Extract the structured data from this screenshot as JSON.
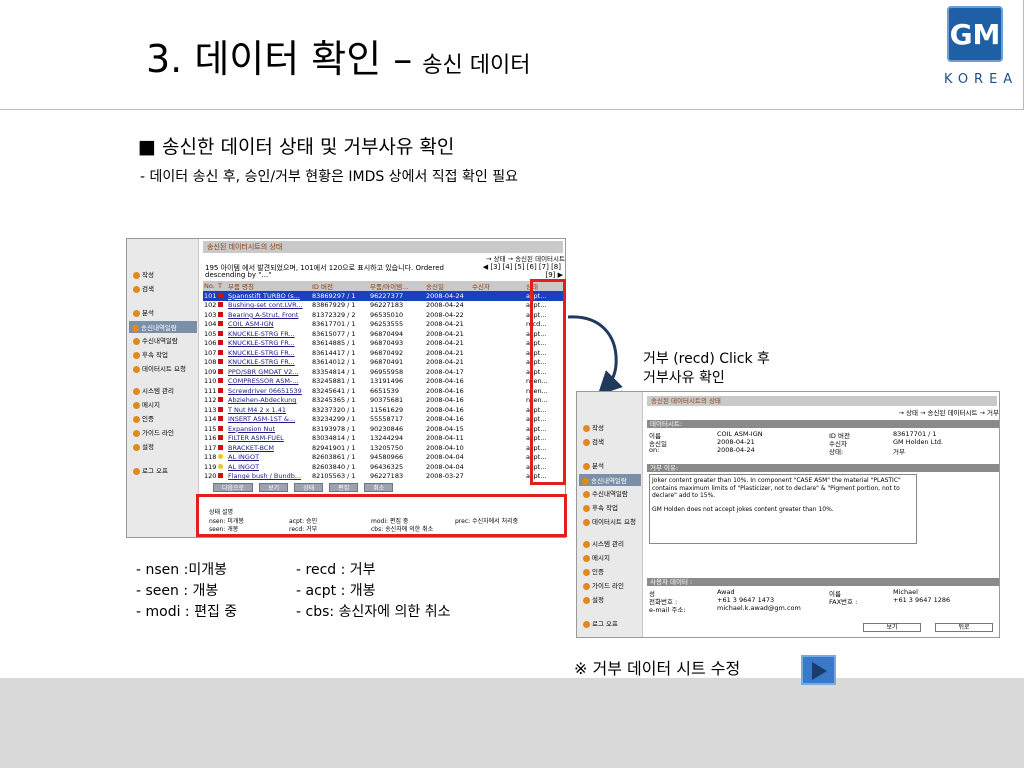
{
  "title": {
    "main": "3. 데이터 확인 –",
    "sub": "송신 데이터"
  },
  "logo": {
    "mark": "GM",
    "sub": "KOREA"
  },
  "heading": "■ 송신한 데이터 상태 및 거부사유 확인",
  "subline": "- 데이터 송신 후, 승인/거부 현황은 IMDS 상에서 직접 확인 필요",
  "screen1": {
    "sidebar": [
      "작성",
      "검색",
      "분석",
      "송신내역일람",
      "수신내역일람",
      "후속 작업",
      "데이터시트 요청",
      "시스템 관리",
      "메시지",
      "인증",
      "가이드 라인",
      "설정",
      "로그 오프"
    ],
    "selected_index": 3,
    "panel_title": "송신된 데이터시트의 상태",
    "legend": "→ 상태 → 송신된 데이터시트",
    "info": "195 아이템 에서 발견되었으며, 101에서 120으로 표시하고 있습니다.   Ordered",
    "info2": "descending by \"...\"",
    "pages": "◀ [3] [4] [5] [6] [7] [8]",
    "pages2": "[9] ▶",
    "columns": [
      "No.",
      "T",
      "부품 명칭",
      "ID 버전",
      "부품/아이템...",
      "송신일",
      "수신자",
      "상태"
    ],
    "rows": [
      [
        "101",
        "",
        "Spannstift TURBO (s...",
        "83869297 / 1",
        "96227377",
        "2008-04-24",
        "",
        "acpt..."
      ],
      [
        "102",
        "",
        "Bushing-set cont.LVR...",
        "83867929 / 1",
        "96227183",
        "2008-04-24",
        "",
        "acpt..."
      ],
      [
        "103",
        "",
        "Bearing A-Strut, Front",
        "81372329 / 2",
        "96535010",
        "2008-04-22",
        "",
        "acpt..."
      ],
      [
        "104",
        "",
        "COIL ASM-IGN",
        "83617701 / 1",
        "96253555",
        "2008-04-21",
        "",
        "recd..."
      ],
      [
        "105",
        "",
        "KNUCKLE-STRG FR...",
        "83615077 / 1",
        "96870494",
        "2008-04-21",
        "",
        "acpt..."
      ],
      [
        "106",
        "",
        "KNUCKLE-STRG FR...",
        "83614885 / 1",
        "96870493",
        "2008-04-21",
        "",
        "acpt..."
      ],
      [
        "107",
        "",
        "KNUCKLE-STRG FR...",
        "83614417 / 1",
        "96870492",
        "2008-04-21",
        "",
        "acpt..."
      ],
      [
        "108",
        "",
        "KNUCKLE-STRG FR...",
        "83614012 / 1",
        "96870491",
        "2008-04-21",
        "",
        "acpt..."
      ],
      [
        "109",
        "",
        "PPD/SBR GMDAT V2...",
        "83354814 / 1",
        "96955958",
        "2008-04-17",
        "",
        "acpt..."
      ],
      [
        "110",
        "",
        "COMPRESSOR ASM-...",
        "83245881 / 1",
        "13191496",
        "2008-04-16",
        "",
        "nsen..."
      ],
      [
        "111",
        "",
        "Screwdriver 06651539",
        "83245641 / 1",
        "6651539",
        "2008-04-16",
        "",
        "nsen..."
      ],
      [
        "112",
        "",
        "Abziehen-Abdeckung",
        "83245365 / 1",
        "90375681",
        "2008-04-16",
        "",
        "nsen..."
      ],
      [
        "113",
        "",
        "T Nut M4 2 x 1.41",
        "83237320 / 1",
        "11561629",
        "2008-04-16",
        "",
        "acpt..."
      ],
      [
        "114",
        "",
        "INSERT ASM-1ST &...",
        "83234299 / 1",
        "55558717",
        "2008-04-16",
        "",
        "acpt..."
      ],
      [
        "115",
        "",
        "Expansion Nut",
        "83193978 / 1",
        "90230846",
        "2008-04-15",
        "",
        "acpt..."
      ],
      [
        "116",
        "",
        "FILTER ASM-FUEL",
        "83034814 / 1",
        "13244294",
        "2008-04-11",
        "",
        "acpt..."
      ],
      [
        "117",
        "",
        "BRACKET-BCM",
        "82941901 / 1",
        "13205750",
        "2008-04-10",
        "",
        "acpt..."
      ],
      [
        "118",
        "",
        "AL INGOT",
        "82603861 / 1",
        "94580966",
        "2008-04-04",
        "",
        "acpt..."
      ],
      [
        "119",
        "",
        "AL INGOT",
        "82603840 / 1",
        "96436325",
        "2008-04-04",
        "",
        "acpt..."
      ],
      [
        "120",
        "",
        "Flange bush / Bundb...",
        "82105563 / 1",
        "96227183",
        "2008-03-27",
        "",
        "acpt..."
      ]
    ],
    "buttons": [
      "다음으로",
      "보기",
      "상태",
      "편집",
      "취소"
    ],
    "status_title": "상태 설명",
    "status": {
      "nsen": "nsen: 미개봉",
      "seen": "seen: 개봉",
      "acpt": "acpt: 승인",
      "recd": "recd: 거부",
      "modi": "modi: 편집 중",
      "cbs": "cbs: 송신자에 의한 취소",
      "prec": "prec: 수신자에서 처리중"
    }
  },
  "note1": {
    "line1": "거부 (recd) Click 후",
    "line2": "거부사유 확인"
  },
  "screen2": {
    "sidebar": [
      "작성",
      "검색",
      "분석",
      "송신내역일람",
      "수신내역일람",
      "후속 작업",
      "데이터시트 요청",
      "시스템 관리",
      "메시지",
      "인증",
      "가이드 라인",
      "설정",
      "로그 오프"
    ],
    "selected_index": 3,
    "panel_title": "송신된 데이터시트의 상태",
    "legend": "→ 상태 → 송신된 데이터시트 → 거부",
    "sec1": "데이터시트:",
    "kv": [
      [
        "이름",
        "COIL ASM-IGN",
        "ID 버전",
        "83617701 / 1"
      ],
      [
        "송신일",
        "2008-04-21",
        "수신자",
        "GM Holden Ltd."
      ],
      [
        "on:",
        "2008-04-24",
        "상태:",
        "거부"
      ]
    ],
    "sec2": "거부 이유:",
    "reason": "Joker content greater than 10%. In component \"CASE ASM\" the material \"PLASTIC\" contains maximum limits of \"Plasticizer, not to declare\" & \"Pigment portion, not to declare\" add to 15%.",
    "reason2": "GM Holden does not accept jokes content greater than 10%.",
    "sec3": "사용자 데이터 :",
    "user": [
      [
        "성",
        "Awad",
        "이름",
        "Michael"
      ],
      [
        "전화번호 :",
        "+61 3 9647 1473",
        "FAX번호 :",
        "+61 3 9647 1286"
      ],
      [
        "e-mail 주소:",
        "michael.k.awad@gm.com",
        "",
        ""
      ]
    ],
    "btn1": "보기",
    "btn2": "뒤로"
  },
  "legend_left": [
    "- nsen :미개봉",
    "- seen : 개봉",
    "- modi : 편집 중"
  ],
  "legend_right": [
    "- recd : 거부",
    "- acpt : 개봉",
    "- cbs: 송신자에 의한 취소"
  ],
  "note2": "※ 거부 데이터 시트 수정",
  "colors": {
    "red_box": "#e21e1e",
    "accent": "#1f5fa6",
    "footer": "#d9d9d9"
  },
  "icons": {
    "next": "play-icon"
  }
}
